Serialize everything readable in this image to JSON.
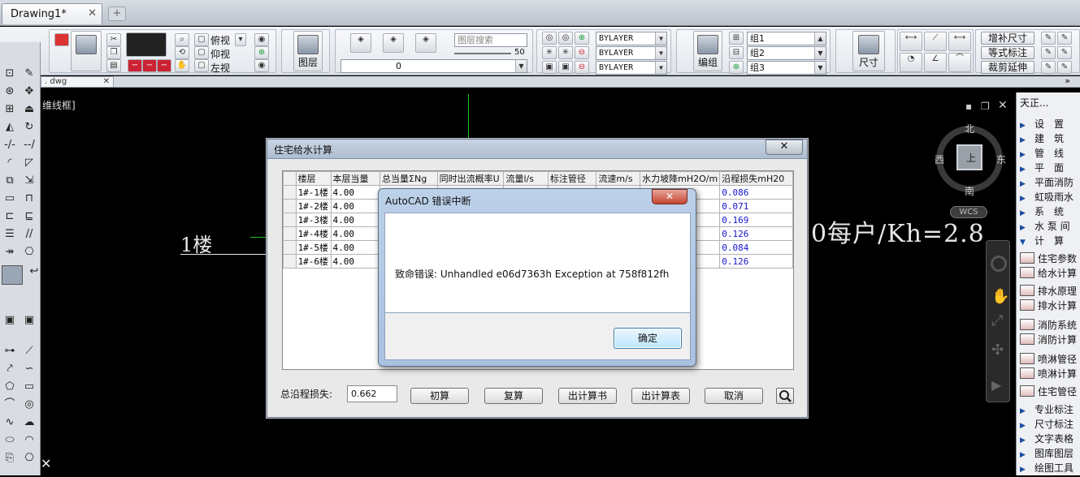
{
  "tabs": {
    "doc_title": "Drawing1*",
    "close": "✕",
    "add": "+"
  },
  "ribbon": {
    "view_top": "俯视",
    "view_bottom": "仰视",
    "view_left": "左视",
    "layer_btn": "图层",
    "layer_search_placeholder": "图层搜索",
    "slider_value": "50",
    "layer_combo": "0",
    "bylayer_1": "BYLAYER",
    "bylayer_2": "BYLAYER",
    "bylayer_3": "BYLAYER",
    "group_btn": "编组",
    "group_1": "组1",
    "group_2": "组2",
    "group_3": "组3",
    "dim_btn": "尺寸",
    "btn_add_dim": "增补尺寸",
    "btn_eq_dim": "等式标注",
    "btn_trim": "裁剪延伸",
    "more": "»"
  },
  "subtab": {
    "dwg": ". dwg",
    "close": "✕"
  },
  "drawing": {
    "model_label": "维线框]",
    "floor_label": "1楼",
    "formula": "0每户/Kh=2.8"
  },
  "viewcube": {
    "north": "北",
    "south": "南",
    "east": "东",
    "west": "西",
    "face": "上",
    "wcs": "WCS"
  },
  "right_panel": {
    "title": "天正...",
    "menu": [
      {
        "label": "设　置",
        "type": "arrow"
      },
      {
        "label": "建　筑",
        "type": "arrow"
      },
      {
        "label": "管　线",
        "type": "arrow"
      },
      {
        "label": "平　面",
        "type": "arrow"
      },
      {
        "label": "平面消防",
        "type": "arrow"
      },
      {
        "label": "虹吸雨水",
        "type": "arrow"
      },
      {
        "label": "系　统",
        "type": "arrow"
      },
      {
        "label": "水 泵 间",
        "type": "arrow"
      },
      {
        "label": "计　算",
        "type": "down"
      },
      {
        "label": "住宅参数",
        "type": "icon"
      },
      {
        "label": "给水计算",
        "type": "icon"
      },
      {
        "label": "排水原理",
        "type": "icon"
      },
      {
        "label": "排水计算",
        "type": "icon"
      },
      {
        "label": "消防系统",
        "type": "icon"
      },
      {
        "label": "消防计算",
        "type": "icon"
      },
      {
        "label": "喷淋管径",
        "type": "icon"
      },
      {
        "label": "喷淋计算",
        "type": "icon"
      },
      {
        "label": "住宅管径",
        "type": "icon"
      },
      {
        "label": "专业标注",
        "type": "arrow"
      },
      {
        "label": "尺寸标注",
        "type": "arrow"
      },
      {
        "label": "文字表格",
        "type": "arrow"
      },
      {
        "label": "图库图层",
        "type": "arrow"
      },
      {
        "label": "绘图工具",
        "type": "arrow"
      }
    ]
  },
  "main_dialog": {
    "title": "住宅给水计算",
    "close": "✕",
    "columns": [
      "楼层",
      "本层当量",
      "总当量ΣNg",
      "同时出流概率U",
      "流量l/s",
      "标注管径",
      "流速m/s",
      "水力坡降mH2O/m",
      "沿程损失mH20"
    ],
    "rows": [
      {
        "floor": "1#-1楼",
        "local": "4.00",
        "loss": "0.086"
      },
      {
        "floor": "1#-2楼",
        "local": "4.00",
        "loss": "0.071"
      },
      {
        "floor": "1#-3楼",
        "local": "4.00",
        "loss": "0.169"
      },
      {
        "floor": "1#-4楼",
        "local": "4.00",
        "loss": "0.126"
      },
      {
        "floor": "1#-5楼",
        "local": "4.00",
        "loss": "0.084"
      },
      {
        "floor": "1#-6楼",
        "local": "4.00",
        "loss": "0.126"
      }
    ],
    "total_label": "总沿程损失:",
    "total_value": "0.662",
    "btn_initial": "初算",
    "btn_recalc": "复算",
    "btn_book": "出计算书",
    "btn_table": "出计算表",
    "btn_cancel": "取消"
  },
  "error_dialog": {
    "title": "AutoCAD 错误中断",
    "close": "✕",
    "message": "致命错误:  Unhandled e06d7363h Exception at 758f812fh",
    "ok": "确定"
  },
  "colors": {
    "canvas": "#000000",
    "error_close": "#c6452f",
    "loss_text": "#1515cc",
    "green_axis": "#1ec21e"
  }
}
